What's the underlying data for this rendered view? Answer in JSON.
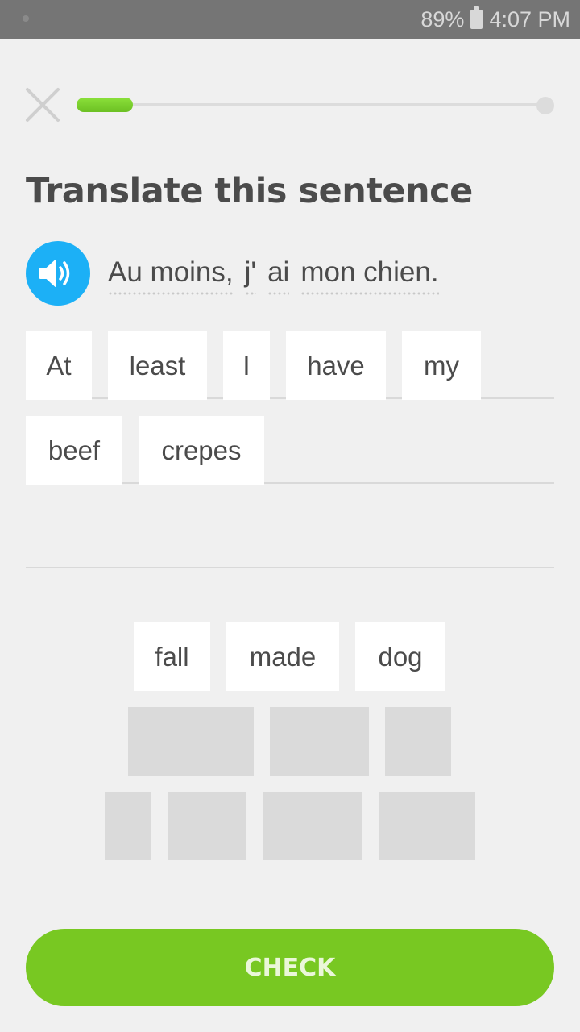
{
  "status_bar": {
    "battery": "89%",
    "time": "4:07 PM"
  },
  "header": {
    "close_icon": "close-icon",
    "progress": 0.12
  },
  "title": "Translate this sentence",
  "prompt": {
    "speaker_icon": "speaker-icon",
    "words": [
      "Au moins,",
      "j'",
      "ai",
      "mon chien."
    ]
  },
  "answer": {
    "tiles": [
      "At",
      "least",
      "I",
      "have",
      "my",
      "beef",
      "crepes"
    ]
  },
  "word_bank": {
    "tiles": [
      "fall",
      "made",
      "dog"
    ],
    "used_slots": 7
  },
  "check_button": "CHECK",
  "colors": {
    "accent_green": "#78c822",
    "progress_green": "#6cc023",
    "speaker_blue": "#1cb0f6",
    "background": "#f0f0f0"
  }
}
